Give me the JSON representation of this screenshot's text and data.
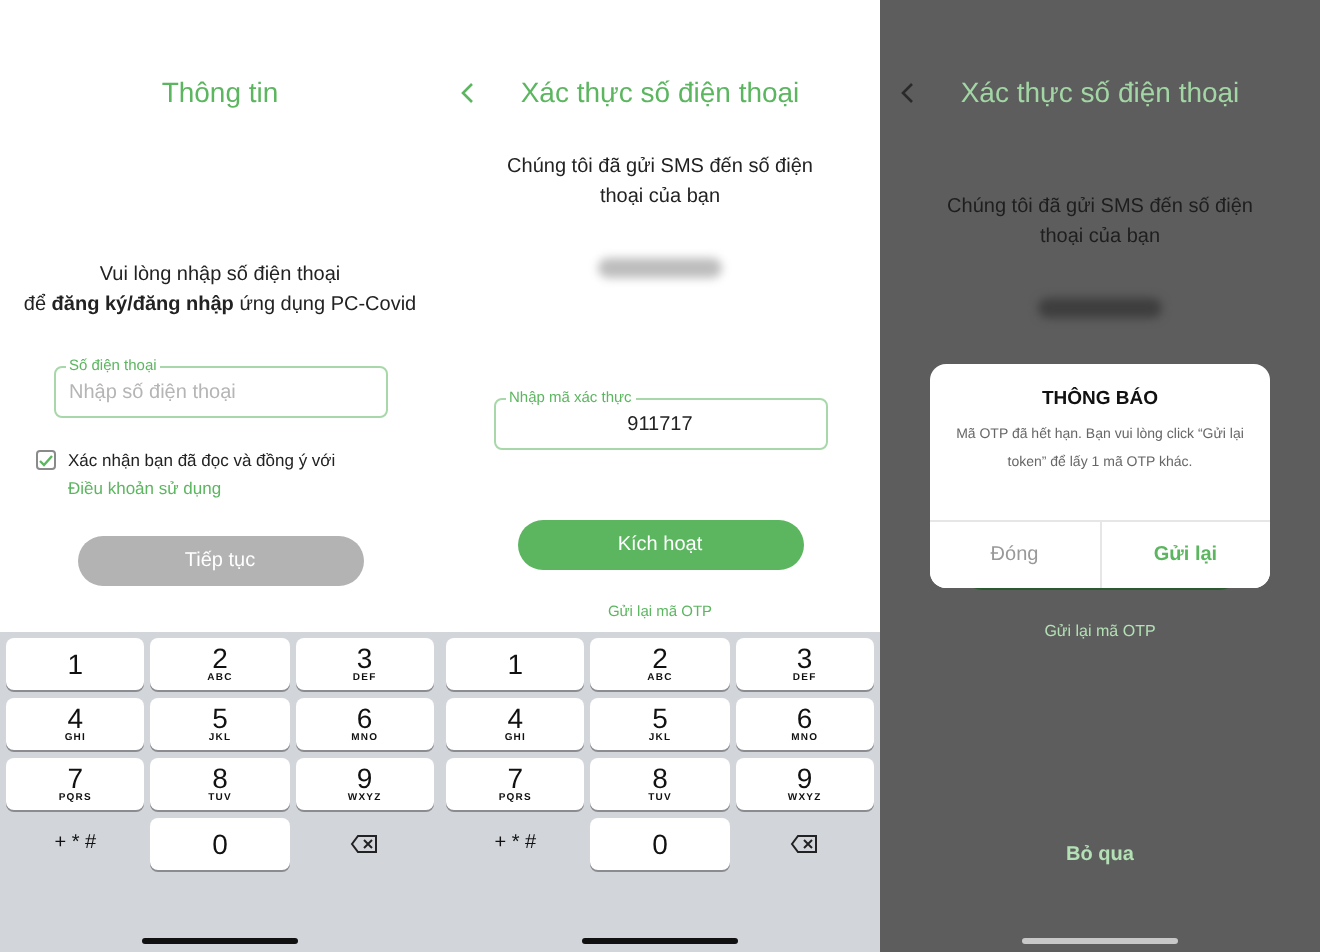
{
  "info_screen": {
    "title": "Thông tin",
    "message_lines": [
      "Vui lòng nhập số điện thoại",
      "để **đăng ký/đăng nhập** ứng dụng PC-Covid"
    ],
    "phone_field": {
      "label": "Số điện thoại",
      "placeholder": "Nhập số điện thoại"
    },
    "consent": {
      "checked": true,
      "text": "Xác nhận bạn đã đọc và đồng ý với",
      "link": "Điều khoản sử dụng"
    },
    "continue_button": {
      "label": "Tiếp tục",
      "disabled": true
    },
    "keyboard": [
      {
        "kind": "digit",
        "digit": "1"
      },
      {
        "kind": "digit",
        "digit": "2",
        "letters": "ABC"
      },
      {
        "kind": "digit",
        "digit": "3",
        "letters": "DEF"
      },
      {
        "kind": "digit",
        "digit": "4",
        "letters": "GHI"
      },
      {
        "kind": "digit",
        "digit": "5",
        "letters": "JKL"
      },
      {
        "kind": "digit",
        "digit": "6",
        "letters": "MNO"
      },
      {
        "kind": "digit",
        "digit": "7",
        "letters": "PQRS"
      },
      {
        "kind": "digit",
        "digit": "8",
        "letters": "TUV"
      },
      {
        "kind": "digit",
        "digit": "9",
        "letters": "WXYZ"
      },
      {
        "kind": "symbols",
        "digit": "+ * #"
      },
      {
        "kind": "digit",
        "digit": "0"
      },
      {
        "kind": "delete"
      }
    ]
  },
  "otp_screen": {
    "title": "Xác thực số điện thoại",
    "message_lines": [
      "Chúng tôi đã gửi SMS đến số điện",
      "thoại của bạn"
    ],
    "code_field": {
      "label": "Nhập mã xác thực",
      "value": "911717"
    },
    "activate_button": {
      "label": "Kích hoạt",
      "disabled": false
    },
    "resend_link": "Gửi lại mã OTP",
    "keyboard": [
      {
        "kind": "digit",
        "digit": "1"
      },
      {
        "kind": "digit",
        "digit": "2",
        "letters": "ABC"
      },
      {
        "kind": "digit",
        "digit": "3",
        "letters": "DEF"
      },
      {
        "kind": "digit",
        "digit": "4",
        "letters": "GHI"
      },
      {
        "kind": "digit",
        "digit": "5",
        "letters": "JKL"
      },
      {
        "kind": "digit",
        "digit": "6",
        "letters": "MNO"
      },
      {
        "kind": "digit",
        "digit": "7",
        "letters": "PQRS"
      },
      {
        "kind": "digit",
        "digit": "8",
        "letters": "TUV"
      },
      {
        "kind": "digit",
        "digit": "9",
        "letters": "WXYZ"
      },
      {
        "kind": "symbols",
        "digit": "+ * #"
      },
      {
        "kind": "digit",
        "digit": "0"
      },
      {
        "kind": "delete"
      }
    ]
  },
  "dialog_screen": {
    "title": "Xác thực số điện thoại",
    "message_lines": [
      "Chúng tôi đã gửi SMS đến số điện",
      "thoại của bạn"
    ],
    "resend_link": "Gửi lại mã OTP",
    "skip_link": "Bỏ qua",
    "dialog": {
      "title": "THÔNG BÁO",
      "message": "Mã OTP đã hết hạn. Bạn vui lòng click “Gửi lại token” để lấy 1 mã OTP khác.",
      "buttons": [
        {
          "label": "Đóng",
          "kind": "secondary"
        },
        {
          "label": "Gửi lại",
          "kind": "primary"
        }
      ]
    }
  }
}
